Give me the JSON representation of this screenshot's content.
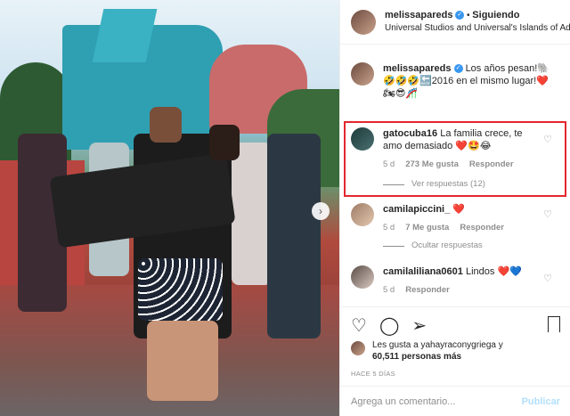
{
  "post": {
    "username": "melissapareds",
    "separator": "•",
    "follow_label": "Siguiendo",
    "location": "Universal Studios and Universal's Islands of Ad..."
  },
  "caption": {
    "username": "melissapareds",
    "text": "Los años pesan!🐘 🤣🤣🤣🔙2016 en el mismo lugar!❤️🏍😎🎢"
  },
  "comments": [
    {
      "username": "gatocuba16",
      "text": "La familia crece, te amo demasiado ❤️🤩😂",
      "time": "5 d",
      "likes": "273 Me gusta",
      "reply_label": "Responder",
      "replies_label": "Ver respuestas (12)"
    },
    {
      "username": "camilapiccini_",
      "text": "❤️",
      "time": "5 d",
      "likes": "7 Me gusta",
      "reply_label": "Responder",
      "replies_label": "Ocultar respuestas"
    },
    {
      "username": "camilaliliana0601",
      "text": "Lindos ❤️💙",
      "time": "5 d",
      "reply_label": "Responder"
    }
  ],
  "likes_line1": "Les gusta a yahayraconygriega y",
  "likes_line2": "60,511 personas más",
  "posted_ago": "HACE 5 DÍAS",
  "comment_input": {
    "placeholder": "Agrega un comentario...",
    "publish_label": "Publicar"
  },
  "icons": {
    "like": "heart-icon",
    "comment": "comment-icon",
    "share": "share-icon",
    "save": "bookmark-icon",
    "next": "chevron-right-icon",
    "verified": "verified-icon"
  },
  "colors": {
    "highlight": "#e4272e",
    "verified": "#3897f0",
    "muted": "#8e8e8e"
  }
}
